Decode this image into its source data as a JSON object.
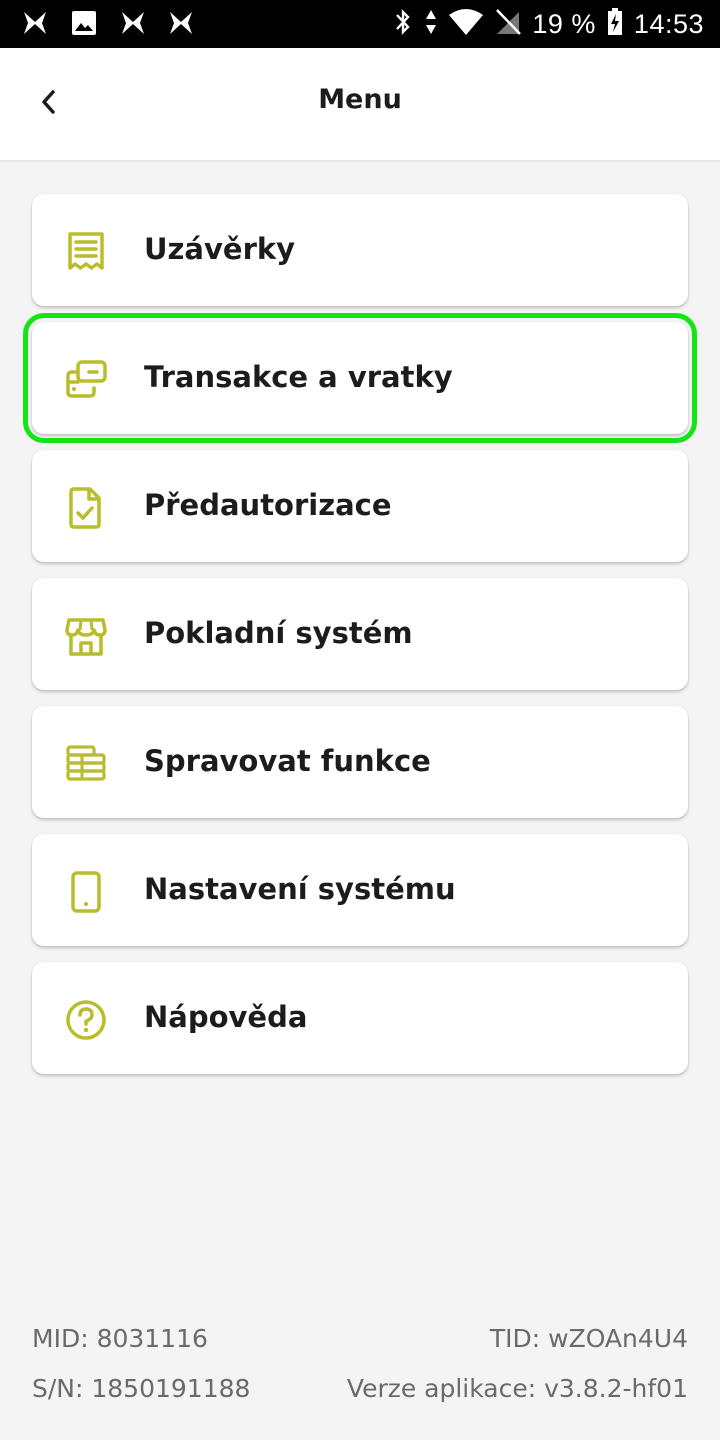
{
  "status_bar": {
    "battery": "19 %",
    "time": "14:53",
    "icons": [
      "app-x-icon",
      "image-icon",
      "app-x-icon",
      "app-x-icon",
      "bluetooth-icon",
      "data-arrows-icon",
      "wifi-icon",
      "no-sim-icon",
      "battery-charging-icon"
    ]
  },
  "header": {
    "title": "Menu",
    "back_icon": "chevron-left-icon"
  },
  "menu": {
    "items": [
      {
        "label": "Uzávěrky",
        "icon": "receipt-icon"
      },
      {
        "label": "Transakce a vratky",
        "icon": "transactions-icon"
      },
      {
        "label": "Předautorizace",
        "icon": "document-check-icon"
      },
      {
        "label": "Pokladní systém",
        "icon": "store-icon"
      },
      {
        "label": "Spravovat funkce",
        "icon": "stack-icon"
      },
      {
        "label": "Nastavení systému",
        "icon": "device-icon"
      },
      {
        "label": "Nápověda",
        "icon": "help-circle-icon"
      }
    ]
  },
  "footer": {
    "mid": "MID:  8031116",
    "tid": "TID:  wZOAn4U4",
    "sn": "S/N: 1850191188",
    "version": "Verze aplikace: v3.8.2-hf01"
  },
  "colors": {
    "accent": "#b9bd2c",
    "highlight": "#14e614",
    "background": "#f4f4f4",
    "text": "#1c1c1c",
    "muted": "#6a6a6a"
  }
}
